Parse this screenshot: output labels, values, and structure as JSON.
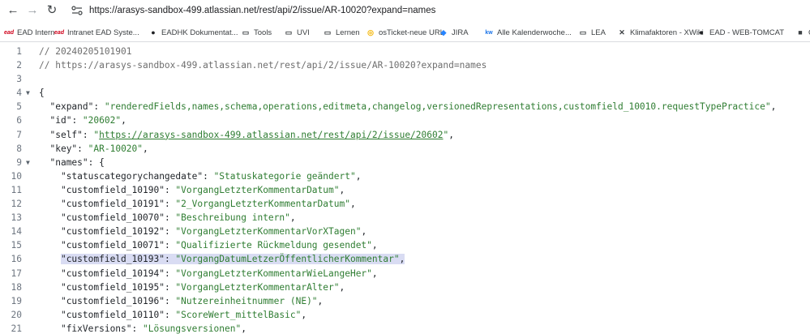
{
  "browser": {
    "url": "https://arasys-sandbox-499.atlassian.net/rest/api/2/issue/AR-10020?expand=names"
  },
  "bookmarks": [
    {
      "label": "EAD Intern",
      "icon": "ead-logo-icon",
      "color": "#d0021b"
    },
    {
      "label": "Intranet EAD Syste...",
      "icon": "ead-logo-icon",
      "color": "#d0021b"
    },
    {
      "label": "EADHK Dokumentat...",
      "icon": "github-icon",
      "color": "#202124"
    },
    {
      "label": "Tools",
      "icon": "folder-icon",
      "color": "#3c4043"
    },
    {
      "label": "UVI",
      "icon": "folder-icon",
      "color": "#3c4043"
    },
    {
      "label": "Lernen",
      "icon": "folder-icon",
      "color": "#3c4043"
    },
    {
      "label": "osTicket-neue URL",
      "icon": "osticket-icon",
      "color": "#3c4043"
    },
    {
      "label": "JIRA",
      "icon": "jira-icon",
      "color": "#3c4043"
    },
    {
      "label": "Alle Kalenderwoche...",
      "icon": "kw-icon",
      "color": "#3c4043"
    },
    {
      "label": "LEA",
      "icon": "folder-icon",
      "color": "#3c4043"
    },
    {
      "label": "Klimafaktoren - XWiki",
      "icon": "xwiki-icon",
      "color": "#3c4043"
    },
    {
      "label": "EAD - WEB-TOMCAT",
      "icon": "github-icon",
      "color": "#202124"
    },
    {
      "label": "G",
      "icon": "generic-icon",
      "color": "#3c4043"
    }
  ],
  "code": {
    "lines": [
      {
        "n": "1",
        "fold": false,
        "highlight": false,
        "tokens": [
          {
            "t": "c",
            "v": "// 20240205101901"
          }
        ]
      },
      {
        "n": "2",
        "fold": false,
        "highlight": false,
        "tokens": [
          {
            "t": "c",
            "v": "// https://arasys-sandbox-499.atlassian.net/rest/api/2/issue/AR-10020?expand=names"
          }
        ]
      },
      {
        "n": "3",
        "fold": false,
        "highlight": false,
        "tokens": []
      },
      {
        "n": "4",
        "fold": true,
        "highlight": false,
        "tokens": [
          {
            "t": "p",
            "v": "{"
          }
        ]
      },
      {
        "n": "5",
        "fold": false,
        "highlight": false,
        "tokens": [
          {
            "t": "p",
            "v": "  "
          },
          {
            "t": "k",
            "v": "\"expand\""
          },
          {
            "t": "p",
            "v": ": "
          },
          {
            "t": "s",
            "v": "\"renderedFields,names,schema,operations,editmeta,changelog,versionedRepresentations,customfield_10010.requestTypePractice\""
          },
          {
            "t": "p",
            "v": ","
          }
        ]
      },
      {
        "n": "6",
        "fold": false,
        "highlight": false,
        "tokens": [
          {
            "t": "p",
            "v": "  "
          },
          {
            "t": "k",
            "v": "\"id\""
          },
          {
            "t": "p",
            "v": ": "
          },
          {
            "t": "s",
            "v": "\"20602\""
          },
          {
            "t": "p",
            "v": ","
          }
        ]
      },
      {
        "n": "7",
        "fold": false,
        "highlight": false,
        "tokens": [
          {
            "t": "p",
            "v": "  "
          },
          {
            "t": "k",
            "v": "\"self\""
          },
          {
            "t": "p",
            "v": ": "
          },
          {
            "t": "s",
            "v": "\""
          },
          {
            "t": "u",
            "v": "https://arasys-sandbox-499.atlassian.net/rest/api/2/issue/20602"
          },
          {
            "t": "s",
            "v": "\""
          },
          {
            "t": "p",
            "v": ","
          }
        ]
      },
      {
        "n": "8",
        "fold": false,
        "highlight": false,
        "tokens": [
          {
            "t": "p",
            "v": "  "
          },
          {
            "t": "k",
            "v": "\"key\""
          },
          {
            "t": "p",
            "v": ": "
          },
          {
            "t": "s",
            "v": "\"AR-10020\""
          },
          {
            "t": "p",
            "v": ","
          }
        ]
      },
      {
        "n": "9",
        "fold": true,
        "highlight": false,
        "tokens": [
          {
            "t": "p",
            "v": "  "
          },
          {
            "t": "k",
            "v": "\"names\""
          },
          {
            "t": "p",
            "v": ": {"
          }
        ]
      },
      {
        "n": "10",
        "fold": false,
        "highlight": false,
        "tokens": [
          {
            "t": "p",
            "v": "    "
          },
          {
            "t": "k",
            "v": "\"statuscategorychangedate\""
          },
          {
            "t": "p",
            "v": ": "
          },
          {
            "t": "s",
            "v": "\"Statuskategorie geändert\""
          },
          {
            "t": "p",
            "v": ","
          }
        ]
      },
      {
        "n": "11",
        "fold": false,
        "highlight": false,
        "tokens": [
          {
            "t": "p",
            "v": "    "
          },
          {
            "t": "k",
            "v": "\"customfield_10190\""
          },
          {
            "t": "p",
            "v": ": "
          },
          {
            "t": "s",
            "v": "\"VorgangLetzterKommentarDatum\""
          },
          {
            "t": "p",
            "v": ","
          }
        ]
      },
      {
        "n": "12",
        "fold": false,
        "highlight": false,
        "tokens": [
          {
            "t": "p",
            "v": "    "
          },
          {
            "t": "k",
            "v": "\"customfield_10191\""
          },
          {
            "t": "p",
            "v": ": "
          },
          {
            "t": "s",
            "v": "\"2_VorgangLetzterKommentarDatum\""
          },
          {
            "t": "p",
            "v": ","
          }
        ]
      },
      {
        "n": "13",
        "fold": false,
        "highlight": false,
        "tokens": [
          {
            "t": "p",
            "v": "    "
          },
          {
            "t": "k",
            "v": "\"customfield_10070\""
          },
          {
            "t": "p",
            "v": ": "
          },
          {
            "t": "s",
            "v": "\"Beschreibung intern\""
          },
          {
            "t": "p",
            "v": ","
          }
        ]
      },
      {
        "n": "14",
        "fold": false,
        "highlight": false,
        "tokens": [
          {
            "t": "p",
            "v": "    "
          },
          {
            "t": "k",
            "v": "\"customfield_10192\""
          },
          {
            "t": "p",
            "v": ": "
          },
          {
            "t": "s",
            "v": "\"VorgangLetzterKommentarVorXTagen\""
          },
          {
            "t": "p",
            "v": ","
          }
        ]
      },
      {
        "n": "15",
        "fold": false,
        "highlight": false,
        "tokens": [
          {
            "t": "p",
            "v": "    "
          },
          {
            "t": "k",
            "v": "\"customfield_10071\""
          },
          {
            "t": "p",
            "v": ": "
          },
          {
            "t": "s",
            "v": "\"Qualifizierte Rückmeldung gesendet\""
          },
          {
            "t": "p",
            "v": ","
          }
        ]
      },
      {
        "n": "16",
        "fold": false,
        "highlight": true,
        "tokens": [
          {
            "t": "p",
            "v": "    "
          },
          {
            "t": "k",
            "v": "\"customfield_10193\""
          },
          {
            "t": "p",
            "v": ": "
          },
          {
            "t": "s",
            "v": "\"VorgangDatumLetzerÖffentlicherKommentar\""
          },
          {
            "t": "p",
            "v": ","
          }
        ]
      },
      {
        "n": "17",
        "fold": false,
        "highlight": false,
        "tokens": [
          {
            "t": "p",
            "v": "    "
          },
          {
            "t": "k",
            "v": "\"customfield_10194\""
          },
          {
            "t": "p",
            "v": ": "
          },
          {
            "t": "s",
            "v": "\"VorgangLetzterKommentarWieLangeHer\""
          },
          {
            "t": "p",
            "v": ","
          }
        ]
      },
      {
        "n": "18",
        "fold": false,
        "highlight": false,
        "tokens": [
          {
            "t": "p",
            "v": "    "
          },
          {
            "t": "k",
            "v": "\"customfield_10195\""
          },
          {
            "t": "p",
            "v": ": "
          },
          {
            "t": "s",
            "v": "\"VorgangLetzterKommentarAlter\""
          },
          {
            "t": "p",
            "v": ","
          }
        ]
      },
      {
        "n": "19",
        "fold": false,
        "highlight": false,
        "tokens": [
          {
            "t": "p",
            "v": "    "
          },
          {
            "t": "k",
            "v": "\"customfield_10196\""
          },
          {
            "t": "p",
            "v": ": "
          },
          {
            "t": "s",
            "v": "\"Nutzereinheitnummer (NE)\""
          },
          {
            "t": "p",
            "v": ","
          }
        ]
      },
      {
        "n": "20",
        "fold": false,
        "highlight": false,
        "tokens": [
          {
            "t": "p",
            "v": "    "
          },
          {
            "t": "k",
            "v": "\"customfield_10110\""
          },
          {
            "t": "p",
            "v": ": "
          },
          {
            "t": "s",
            "v": "\"ScoreWert_mittelBasic\""
          },
          {
            "t": "p",
            "v": ","
          }
        ]
      },
      {
        "n": "21",
        "fold": false,
        "highlight": false,
        "tokens": [
          {
            "t": "p",
            "v": "    "
          },
          {
            "t": "k",
            "v": "\"fixVersions\""
          },
          {
            "t": "p",
            "v": ": "
          },
          {
            "t": "s",
            "v": "\"Lösungsversionen\""
          },
          {
            "t": "p",
            "v": ","
          }
        ]
      }
    ]
  }
}
